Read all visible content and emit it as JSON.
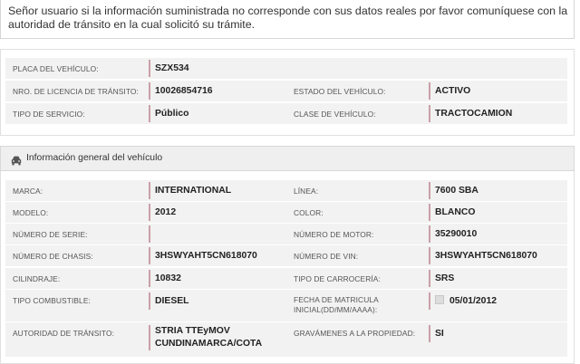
{
  "notice": {
    "text": "Señor usuario si la información suministrada no corresponde con sus datos reales por favor comuníquese con la autoridad de tránsito en la cual solicitó su trámite."
  },
  "summary": {
    "placa_label": "PLACA DEL VEHÍCULO:",
    "placa_value": "SZX534",
    "licencia_label": "NRO. DE LICENCIA DE TRÁNSITO:",
    "licencia_value": "10026854716",
    "estado_label": "ESTADO DEL VEHÍCULO:",
    "estado_value": "ACTIVO",
    "servicio_label": "TIPO DE SERVICIO:",
    "servicio_value": "Público",
    "clase_label": "CLASE DE VEHÍCULO:",
    "clase_value": "TRACTOCAMION"
  },
  "section": {
    "icon": "car-icon",
    "title": "Información general del vehículo"
  },
  "details": {
    "marca_label": "MARCA:",
    "marca_value": "INTERNATIONAL",
    "linea_label": "LÍNEA:",
    "linea_value": "7600 SBA",
    "modelo_label": "MODELO:",
    "modelo_value": "2012",
    "color_label": "COLOR:",
    "color_value": "BLANCO",
    "serie_label": "NÚMERO DE SERIE:",
    "serie_value": "",
    "motor_label": "NÚMERO DE MOTOR:",
    "motor_value": "35290010",
    "chasis_label": "NÚMERO DE CHASIS:",
    "chasis_value": "3HSWYAHT5CN618070",
    "vin_label": "NÚMERO DE VIN:",
    "vin_value": "3HSWYAHT5CN618070",
    "cilindraje_label": "CILINDRAJE:",
    "cilindraje_value": "10832",
    "carroceria_label": "TIPO DE CARROCERÍA:",
    "carroceria_value": "SRS",
    "combustible_label": "TIPO COMBUSTIBLE:",
    "combustible_value": "DIESEL",
    "fecha_label": "FECHA DE MATRICULA INICIAL(DD/MM/AAAA):",
    "fecha_value": "05/01/2012",
    "autoridad_label": "AUTORIDAD DE TRÁNSITO:",
    "autoridad_value": "STRIA TTEyMOV CUNDINAMARCA/COTA",
    "gravamenes_label": "GRAVÁMENES A LA PROPIEDAD:",
    "gravamenes_value": "SI"
  },
  "colors": {
    "row_bg": "#f2f2f2",
    "value_border": "#c9a0a8",
    "header_bg": "#efefef"
  }
}
